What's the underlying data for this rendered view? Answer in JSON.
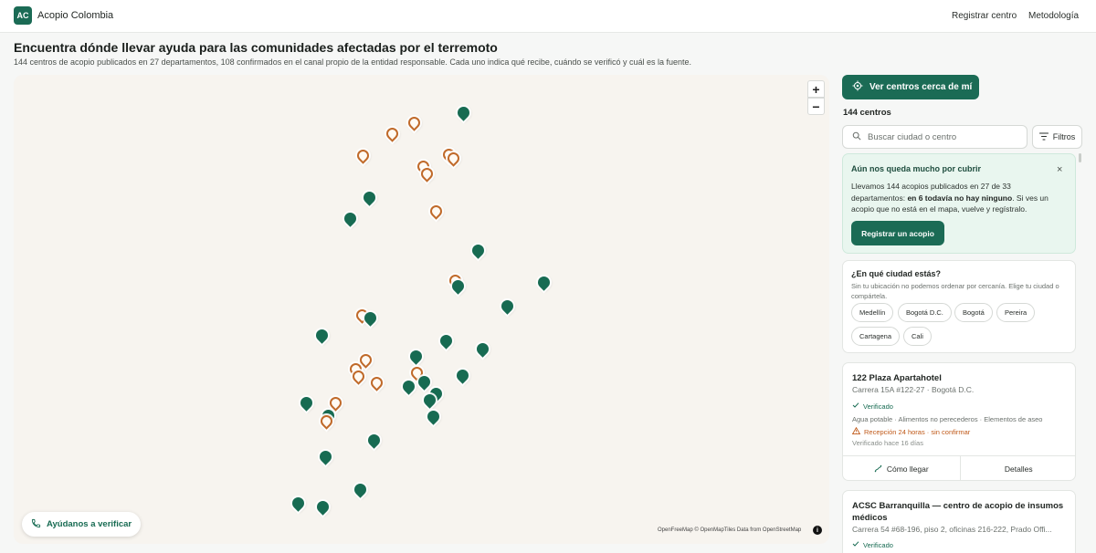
{
  "app": {
    "logo_text": "AC",
    "name": "Acopio Colombia"
  },
  "nav": {
    "register": "Registrar centro",
    "methodology": "Metodología"
  },
  "header": {
    "title": "Encuentra dónde llevar ayuda para las comunidades afectadas por el terremoto",
    "subtitle": "144 centros de acopio publicados en 27 departamentos, 108 confirmados en el canal propio de la entidad responsable. Cada uno indica qué recibe, cuándo se verificó y cuál es la fuente."
  },
  "map": {
    "zoom_in": "+",
    "zoom_out": "−",
    "help_button": "Ayúdanos a verificar",
    "attribution": "OpenFreeMap © OpenMapTiles Data from OpenStreetMap",
    "info": "i",
    "pin_colors": {
      "confirmed": "#176b52",
      "pending": "#c06a2a"
    }
  },
  "sidebar": {
    "near_button": "Ver centros cerca de mí",
    "count_label": "144 centros",
    "search_placeholder": "Buscar ciudad o centro",
    "filters_label": "Filtros",
    "notice": {
      "title": "Aún nos queda mucho por cubrir",
      "close": "×",
      "body_prefix": "Llevamos 144 acopios publicados en 27 de 33 departamentos: ",
      "body_bold": "en 6 todavía no hay ninguno",
      "body_suffix": ". Si ves un acopio que no está en el mapa, vuelve y regístralo.",
      "button": "Registrar un acopio"
    },
    "city": {
      "title": "¿En qué ciudad estás?",
      "subtitle": "Sin tu ubicación no podemos ordenar por cercanía. Elige tu ciudad o compártela.",
      "chips": [
        "Medellín",
        "Bogotá D.C.",
        "Bogotá",
        "Pereira",
        "Cartagena",
        "Cali"
      ]
    },
    "cards": [
      {
        "name": "122 Plaza Apartahotel",
        "address": "Carrera 15A #122-27 · Bogotá D.C.",
        "verified": "Verificado",
        "accepts": "Agua potable · Alimentos no perecederos · Elementos de aseo",
        "warning": "Recepción 24 horas · sin confirmar",
        "checked": "Verificado hace 16 días",
        "directions": "Cómo llegar",
        "details": "Detalles"
      },
      {
        "name": "ACSC Barranquilla — centro de acopio de insumos médicos",
        "address": "Carrera 54 #68-196, piso 2, oficinas 216-222, Prado Offi...",
        "verified": "Verificado"
      }
    ]
  }
}
